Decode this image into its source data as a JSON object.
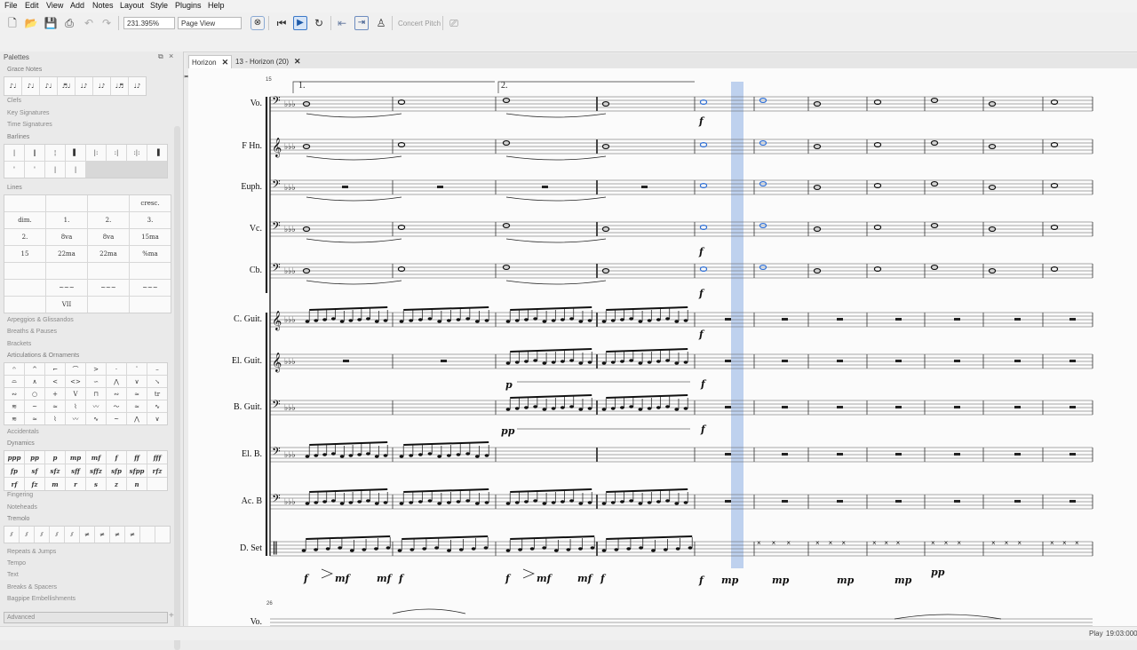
{
  "menu": [
    "File",
    "Edit",
    "View",
    "Add",
    "Notes",
    "Layout",
    "Style",
    "Plugins",
    "Help"
  ],
  "toolbar": {
    "zoom": "231.395%",
    "view_mode": "Page View",
    "concert_pitch": "Concert Pitch",
    "voices": [
      "1",
      "2",
      "3",
      "4"
    ]
  },
  "palettes": {
    "title": "Palettes",
    "sections": {
      "grace_notes": "Grace Notes",
      "clefs": "Clefs",
      "key_signatures": "Key Signatures",
      "time_signatures": "Time Signatures",
      "barlines": "Barlines",
      "lines": "Lines",
      "arpeggios": "Arpeggios & Glissandos",
      "breaths": "Breaths & Pauses",
      "brackets": "Brackets",
      "articulations": "Articulations & Ornaments",
      "accidentals": "Accidentals",
      "dynamics": "Dynamics",
      "fingering": "Fingering",
      "noteheads": "Noteheads",
      "tremolo": "Tremolo",
      "repeats": "Repeats & Jumps",
      "tempo": "Tempo",
      "text": "Text",
      "breaks": "Breaks & Spacers",
      "bagpipe": "Bagpipe Embellishments"
    },
    "lines_items": [
      "",
      "",
      "",
      "cresc.",
      "dim.",
      "1.",
      "2.",
      "3.",
      "2.",
      "8va",
      "8va",
      "15ma",
      "15",
      "22ma",
      "22ma",
      "%ma",
      "",
      "",
      "",
      "",
      "",
      "~~~",
      "~~~",
      "~~~",
      "",
      "VII",
      "",
      ""
    ],
    "dynamics_items": [
      "ppp",
      "pp",
      "p",
      "mp",
      "mf",
      "f",
      "ff",
      "fff",
      "fp",
      "sf",
      "sfz",
      "sff",
      "sffz",
      "sfp",
      "sfpp",
      "rfz",
      "rf",
      "fz",
      "m",
      "r",
      "s",
      "z",
      "n",
      ""
    ],
    "advanced": "Advanced"
  },
  "tabs": [
    {
      "label": "Horizon",
      "active": true
    },
    {
      "label": "13 - Horizon (20)",
      "active": false
    }
  ],
  "score": {
    "measure_start": "15",
    "next_system_start": "26",
    "volta1": "1.",
    "volta2": "2.",
    "instruments": [
      "Vo.",
      "F Hn.",
      "Euph.",
      "Vc.",
      "Cb.",
      "C. Guit.",
      "El. Guit.",
      "B. Guit.",
      "El. B.",
      "Ac. B",
      "D. Set"
    ],
    "next_system_instrument": "Vo.",
    "dynamics": {
      "f": "f",
      "p": "p",
      "pp": "pp",
      "mf": "mf",
      "mp": "mp"
    }
  },
  "status": {
    "mode": "Play",
    "time": "19:03:000"
  },
  "colors": {
    "accent": "#3a78c8",
    "playhead": "#a9c3ea",
    "selected_note": "#2e6fd6"
  }
}
